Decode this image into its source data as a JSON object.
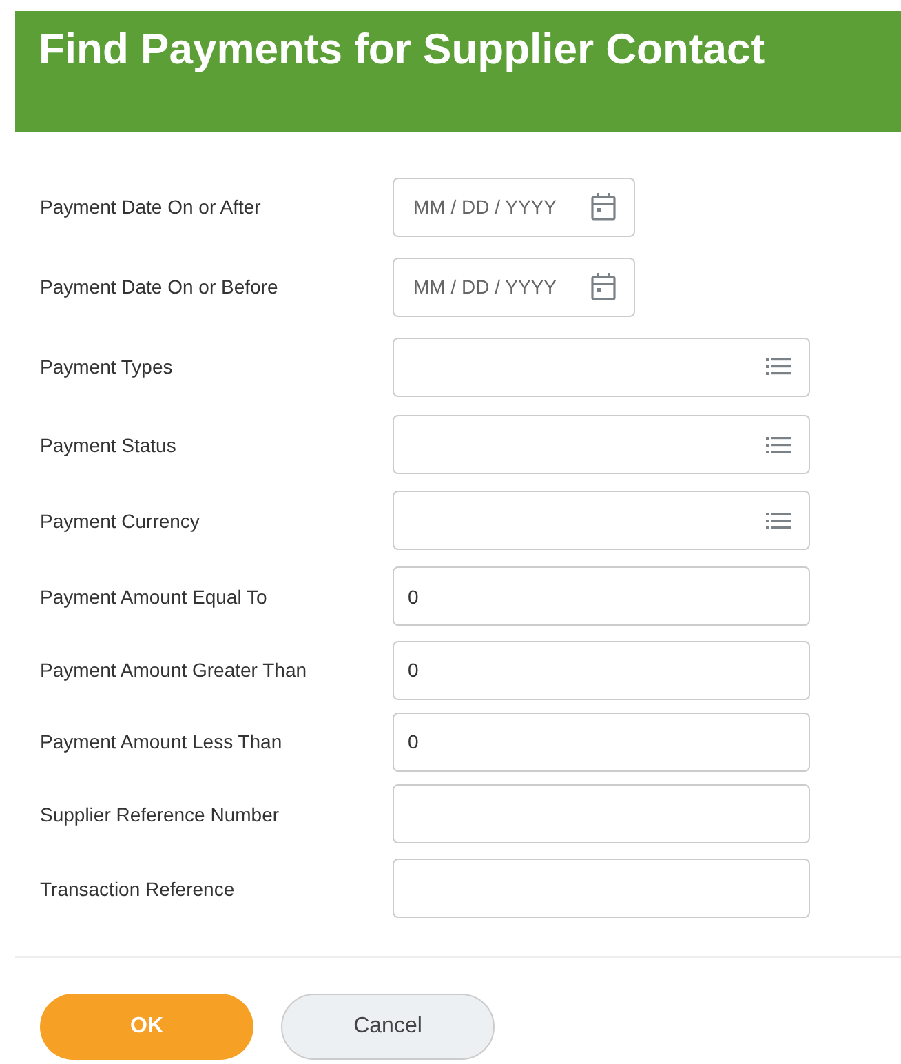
{
  "window": {
    "title": "Find Payments for Supplier Contact"
  },
  "fields": [
    {
      "label": "Payment Date On or After",
      "kind": "date",
      "placeholder": "MM / DD / YYYY"
    },
    {
      "label": "Payment Date On or Before",
      "kind": "date",
      "placeholder": "MM / DD / YYYY"
    },
    {
      "label": "Payment Types",
      "kind": "select"
    },
    {
      "label": "Payment Status",
      "kind": "select"
    },
    {
      "label": "Payment Currency",
      "kind": "select"
    },
    {
      "label": "Payment Amount Equal To",
      "kind": "text",
      "value": "0"
    },
    {
      "label": "Payment Amount Greater Than",
      "kind": "text",
      "value": "0"
    },
    {
      "label": "Payment Amount Less Than",
      "kind": "text",
      "value": "0"
    },
    {
      "label": "Supplier Reference Number",
      "kind": "text"
    },
    {
      "label": "Transaction Reference",
      "kind": "text"
    }
  ],
  "buttons": [
    {
      "label": "OK",
      "kind": "primary"
    },
    {
      "label": "Cancel",
      "kind": "secondary"
    }
  ]
}
